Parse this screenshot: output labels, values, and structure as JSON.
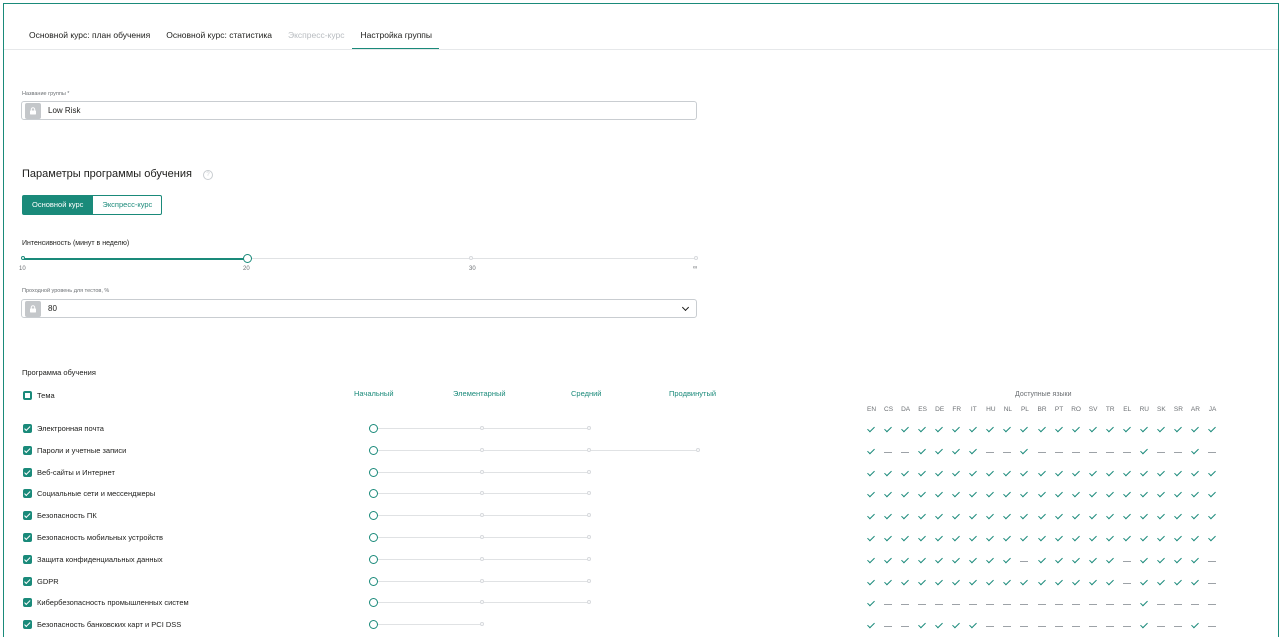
{
  "tabs": [
    {
      "label": "Основной курс: план обучения",
      "state": "normal"
    },
    {
      "label": "Основной курс: статистика",
      "state": "normal"
    },
    {
      "label": "Экспресс-курс",
      "state": "disabled"
    },
    {
      "label": "Настройка группы",
      "state": "active"
    }
  ],
  "group_name": {
    "label": "Название группы *",
    "value": "Low Risk",
    "icon": "lock-icon"
  },
  "program": {
    "title": "Параметры программы обучения",
    "help_icon": "help-icon",
    "course_toggle": {
      "main_label": "Основной курс",
      "express_label": "Экспресс-курс",
      "selected": "Основной курс"
    },
    "intensity": {
      "label": "Интенсивность (минут в неделю)",
      "ticks": [
        "10",
        "20",
        "30",
        "∞"
      ],
      "value": "20"
    },
    "pass_level": {
      "label": "Проходной уровень для тестов, %",
      "value": "80",
      "icon": "lock-icon"
    }
  },
  "curriculum": {
    "title": "Программа обучения",
    "topic_header": "Тема",
    "levels": [
      "Начальный",
      "Элементарный",
      "Средний",
      "Продвинутый"
    ],
    "languages_title": "Доступные языки",
    "languages": [
      "EN",
      "CS",
      "DA",
      "ES",
      "DE",
      "FR",
      "IT",
      "HU",
      "NL",
      "PL",
      "BR",
      "PT",
      "RO",
      "SV",
      "TR",
      "EL",
      "RU",
      "SK",
      "SR",
      "AR",
      "JA"
    ],
    "topics": [
      {
        "name": "Электронная почта",
        "level_count": 3,
        "selected_level": "Начальный",
        "langs": "111111111111111111111"
      },
      {
        "name": "Пароли и учетные записи",
        "level_count": 4,
        "selected_level": "Начальный",
        "langs": "100111100100000010010"
      },
      {
        "name": "Веб-сайты и Интернет",
        "level_count": 3,
        "selected_level": "Начальный",
        "langs": "111111111111111111111"
      },
      {
        "name": "Социальные сети и мессенджеры",
        "level_count": 3,
        "selected_level": "Начальный",
        "langs": "111111111111111111111"
      },
      {
        "name": "Безопасность ПК",
        "level_count": 3,
        "selected_level": "Начальный",
        "langs": "111111111111111111111"
      },
      {
        "name": "Безопасность мобильных устройств",
        "level_count": 3,
        "selected_level": "Начальный",
        "langs": "111111111111111111111"
      },
      {
        "name": "Защита конфиденциальных данных",
        "level_count": 3,
        "selected_level": "Начальный",
        "langs": "111111111011111011110"
      },
      {
        "name": "GDPR",
        "level_count": 3,
        "selected_level": "Начальный",
        "langs": "111111111111111011110"
      },
      {
        "name": "Кибербезопасность промышленных систем",
        "level_count": 3,
        "selected_level": "Начальный",
        "langs": "100000000000000010000"
      },
      {
        "name": "Безопасность банковских карт и PCI DSS",
        "level_count": 2,
        "selected_level": "Начальный",
        "langs": "100111100000000010010"
      }
    ]
  },
  "colors": {
    "accent": "#1a8a7a",
    "text": "#1d1d1b",
    "muted": "#6b6f73",
    "disabled": "#b8bcc0"
  }
}
